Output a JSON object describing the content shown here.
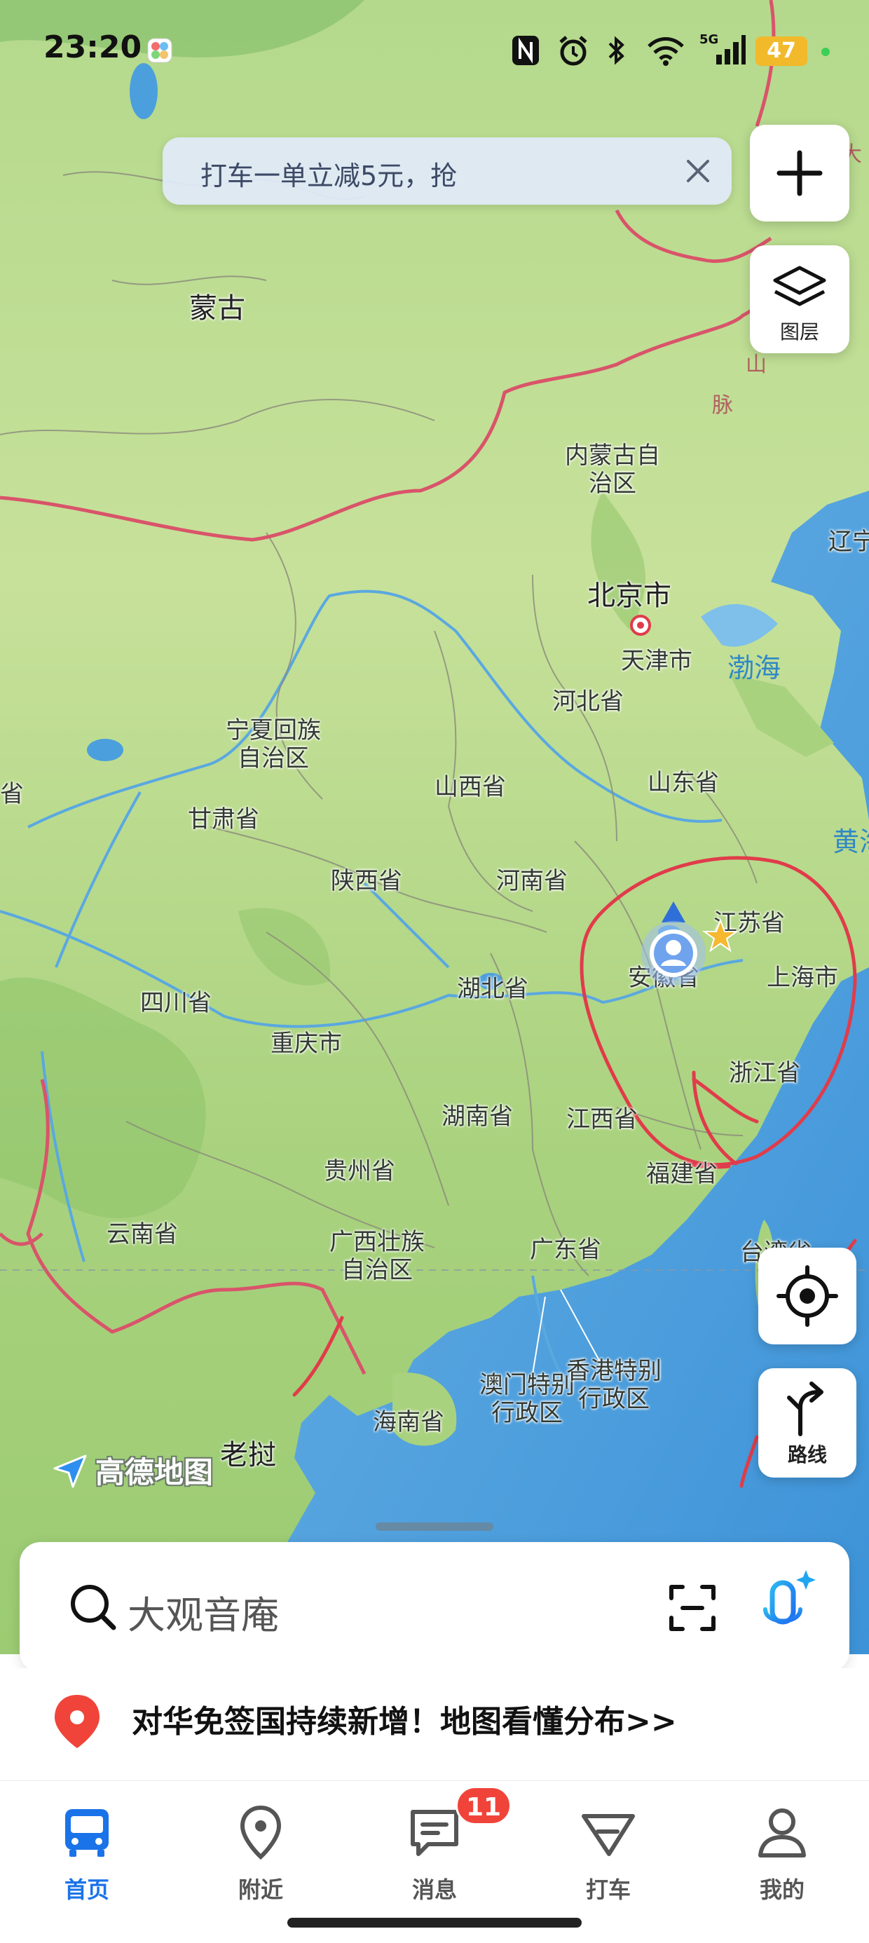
{
  "status_bar": {
    "time": "23:20",
    "battery": "47",
    "network": "5G",
    "icons": [
      "app-badge-icon",
      "nfc-icon",
      "alarm-icon",
      "bluetooth-icon",
      "wifi-icon",
      "signal-icon",
      "battery-icon"
    ]
  },
  "promo_banner": {
    "text": "打车一单立减5元，抢"
  },
  "map_controls": {
    "layers_label": "图层",
    "route_label": "路线"
  },
  "map_labels": {
    "mongolia": "蒙古",
    "inner_mongolia_1": "内蒙古自",
    "inner_mongolia_2": "治区",
    "beijing": "北京市",
    "tianjin": "天津市",
    "hebei": "河北省",
    "bohai": "渤海",
    "liaoning": "辽宁",
    "ningxia_1": "宁夏回族",
    "ningxia_2": "自治区",
    "shanxi": "山西省",
    "shandong": "山东省",
    "gansu": "甘肃省",
    "qinghai": "省",
    "yellow_sea": "黄海",
    "shaanxi": "陕西省",
    "henan": "河南省",
    "jiangsu": "江苏省",
    "anhui": "安徽省",
    "shanghai": "上海市",
    "sichuan": "四川省",
    "hubei": "湖北省",
    "chongqing": "重庆市",
    "zhejiang": "浙江省",
    "hunan": "湖南省",
    "jiangxi": "江西省",
    "guizhou": "贵州省",
    "fujian": "福建省",
    "yunnan": "云南省",
    "guangxi_1": "广西壮族",
    "guangxi_2": "自治区",
    "guangdong": "广东省",
    "taiwan": "台湾省",
    "macau_1": "澳门特别",
    "macau_2": "行政区",
    "hongkong_1": "香港特别",
    "hongkong_2": "行政区",
    "hainan": "海南省",
    "laos": "老挝",
    "range_1": "山",
    "range_2": "脉",
    "north_corner": "大"
  },
  "logo": {
    "text": "高德地图"
  },
  "search": {
    "placeholder": "大观音庵"
  },
  "news": {
    "text": "对华免签国持续新增！地图看懂分布>>"
  },
  "tabs": [
    {
      "label": "首页",
      "icon": "bus-icon",
      "active": true
    },
    {
      "label": "附近",
      "icon": "location-pin-icon",
      "active": false
    },
    {
      "label": "消息",
      "icon": "message-icon",
      "active": false,
      "badge": "11"
    },
    {
      "label": "打车",
      "icon": "taxi-icon",
      "active": false
    },
    {
      "label": "我的",
      "icon": "profile-icon",
      "active": false
    }
  ],
  "colors": {
    "accent": "#1a73e8",
    "badge": "#f0443a",
    "border_red": "#d9546a",
    "sea": "#4b9fdd"
  }
}
